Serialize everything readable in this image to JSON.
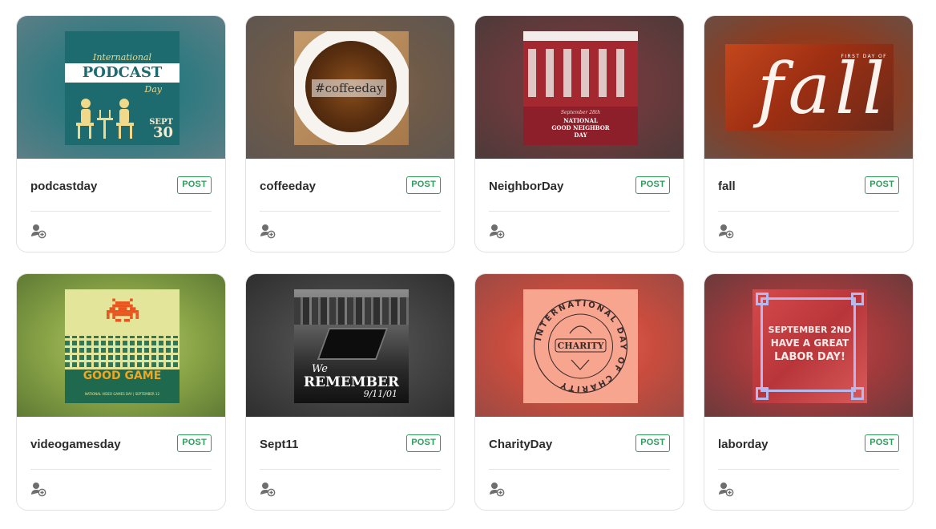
{
  "cards": [
    {
      "title": "podcastday",
      "badge": "POST",
      "art": {
        "line1": "International",
        "line2": "PODCAST",
        "line3": "Day",
        "date1": "SEPT",
        "date2": "30"
      },
      "colors": {
        "bg": "#1f6e72"
      }
    },
    {
      "title": "coffeeday",
      "badge": "POST",
      "art": {
        "tag": "#coffeeday"
      },
      "colors": {
        "bg": "#6f5a48"
      }
    },
    {
      "title": "NeighborDay",
      "badge": "POST",
      "art": {
        "line1": "September 28th",
        "line2": "NATIONAL",
        "line3": "GOOD NEIGHBOR",
        "line4": "DAY"
      },
      "colors": {
        "bg": "#6a3a3c"
      }
    },
    {
      "title": "fall",
      "badge": "POST",
      "art": {
        "small": "FIRST DAY OF",
        "big": "fall"
      },
      "colors": {
        "bg": "#b7421a"
      }
    },
    {
      "title": "videogamesday",
      "badge": "POST",
      "art": {
        "line1": "GOOD GAME",
        "line2": "NATIONAL VIDEO GAMES DAY | SEPTEMBER 12"
      },
      "colors": {
        "bg": "#8aa547"
      }
    },
    {
      "title": "Sept11",
      "badge": "POST",
      "art": {
        "line1": "We",
        "line2": "REMEMBER",
        "line3": "9/11/01"
      },
      "colors": {
        "bg": "#454545"
      }
    },
    {
      "title": "CharityDay",
      "badge": "POST",
      "art": {
        "ring": "INTERNATIONAL DAY OF CHARITY",
        "center": "CHARITY"
      },
      "colors": {
        "bg": "#c94c3e"
      }
    },
    {
      "title": "laborday",
      "badge": "POST",
      "art": {
        "line1": "SEPTEMBER 2ND",
        "line2": "HAVE A GREAT",
        "line3": "LABOR DAY!"
      },
      "colors": {
        "bg": "#a23a3c"
      }
    }
  ],
  "icons": {
    "assign": "add-user-icon"
  }
}
